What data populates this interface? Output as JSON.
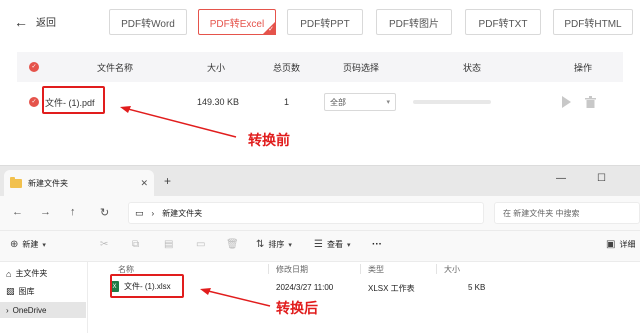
{
  "converter": {
    "back_label": "返回",
    "formats": [
      "PDF转Word",
      "PDF转Excel",
      "PDF转PPT",
      "PDF转图片",
      "PDF转TXT",
      "PDF转HTML"
    ],
    "active_format": "PDF转Excel",
    "columns": {
      "name": "文件名称",
      "size": "大小",
      "pages": "总页数",
      "page_select": "页码选择",
      "status": "状态",
      "actions": "操作"
    },
    "row": {
      "file_name": "文件- (1).pdf",
      "size": "149.30 KB",
      "pages": "1",
      "page_select_value": "全部"
    },
    "annotation_before": "转换前"
  },
  "explorer": {
    "tab_title": "新建文件夹",
    "address": "新建文件夹",
    "search_placeholder": "在 新建文件夹 中搜索",
    "toolbar": {
      "new_label": "新建",
      "sort_label": "排序",
      "view_label": "查看",
      "more_label": "···",
      "details_label": "详细"
    },
    "nav": [
      "主文件夹",
      "图库",
      "OneDrive"
    ],
    "columns": {
      "name": "名称",
      "modified": "修改日期",
      "type": "类型",
      "size": "大小"
    },
    "file": {
      "name": "文件- (1).xlsx",
      "modified": "2024/3/27 11:00",
      "type": "XLSX 工作表",
      "size": "5 KB"
    },
    "annotation_after": "转换后"
  },
  "colors": {
    "accent": "#e5534b",
    "annotation": "#e11d1d"
  }
}
